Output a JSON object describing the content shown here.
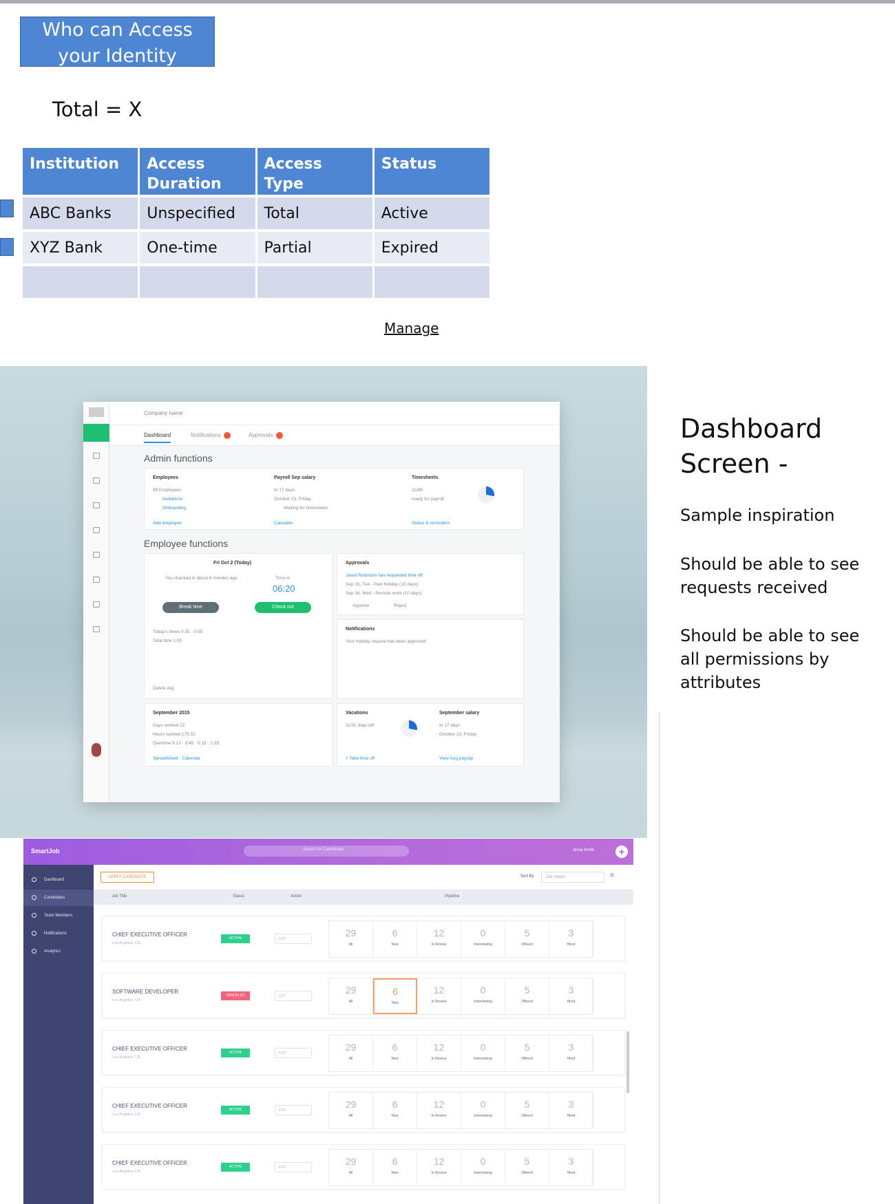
{
  "header": {
    "title": "Who can Access your Identity",
    "total": "Total = X"
  },
  "access_table": {
    "columns": [
      "Institution",
      "Access Duration",
      "Access Type",
      "Status"
    ],
    "rows": [
      [
        "ABC Banks",
        "Unspecified",
        "Total",
        "Active"
      ],
      [
        "XYZ Bank",
        "One-time",
        "Partial",
        "Expired"
      ],
      [
        "",
        "",
        "",
        ""
      ]
    ],
    "manage_link": "Manage"
  },
  "dashboard1": {
    "company": "Company name",
    "tabs": [
      "Dashboard",
      "Notifications",
      "Approvals"
    ],
    "admin_title": "Admin functions",
    "employee_title": "Employee functions",
    "cards": {
      "employees": {
        "title": "Employees",
        "lines": [
          "98 Employees",
          "Invitations",
          "Onboarding"
        ],
        "link": "Add employee"
      },
      "payroll": {
        "title": "Payroll  Sep salary",
        "lines": [
          "In 17 days",
          "October 23, Friday",
          "Waiting for timesheets"
        ],
        "link": "Calculate"
      },
      "timesheets": {
        "title": "Timesheets",
        "lines": [
          "11/98",
          "ready for payroll"
        ],
        "link": "Status & reminders"
      },
      "clock": {
        "title": "Fri Oct 2 (Today)",
        "checked": "You checked in about 6 minutes ago",
        "time_label": "Time in",
        "time": "06:20",
        "break": "Break time",
        "checkout": "Check out",
        "today": "Today's times  0:35 · 0:55",
        "total": "Total time  1:00",
        "delete": "Delete day"
      },
      "approvals": {
        "title": "Approvals",
        "lines": [
          "Jared Robinson has requested time off",
          "Sep 15, Tue - Paid holiday (10 days)",
          "Sep 16, Wed - Remote work (10 days)"
        ],
        "approve": "Approve",
        "reject": "Reject"
      },
      "notifications": {
        "title": "Notifications",
        "lines": [
          "Your holiday request has been approved"
        ]
      },
      "september": {
        "title": "September 2015",
        "lines": [
          "Days worked  22",
          "Hours worked  176:32",
          "Overtime  8:12 · 3:45 · 0:15 · 1:35"
        ],
        "links": "Spreadsheet · Calendar"
      },
      "vacations": {
        "title": "Vacations",
        "lines": [
          "11/31 days left"
        ],
        "link": "+ Take time off"
      },
      "sep_salary": {
        "title": "September salary",
        "lines": [
          "In 17 days",
          "October 23, Friday"
        ],
        "link": "View Aug payslip"
      }
    }
  },
  "smartjob": {
    "brand": "SmartJob",
    "search_placeholder": "Search for Candidates",
    "user": "Anna Smith",
    "nav": [
      "Dashboard",
      "Candidates",
      "Team Members",
      "Notifications",
      "Analytics"
    ],
    "apply_button": "APPLY CANDIDATE",
    "sort_label": "Sort By",
    "sort_value": "Job Status",
    "columns": [
      "Job Title",
      "Status",
      "Action",
      "Pipeline"
    ],
    "pipeline_labels": [
      "All",
      "New",
      "In Review",
      "Interviewing",
      "Offered",
      "Hired"
    ],
    "jobs": [
      {
        "title": "CHIEF EXECUTIVE OFFICER",
        "location": "Los Angeles, CA",
        "status": "ACTIVE",
        "action": "EDIT",
        "pipeline": [
          29,
          6,
          12,
          0,
          5,
          3
        ]
      },
      {
        "title": "SOFTWARE DEVELOPER",
        "location": "Los Angeles, CA",
        "status": "CANCELED",
        "action": "EDIT",
        "pipeline": [
          29,
          6,
          12,
          0,
          5,
          3
        ]
      },
      {
        "title": "CHIEF EXECUTIVE OFFICER",
        "location": "Los Angeles, CA",
        "status": "ACTIVE",
        "action": "EDIT",
        "pipeline": [
          29,
          6,
          12,
          0,
          5,
          3
        ]
      },
      {
        "title": "CHIEF EXECUTIVE OFFICER",
        "location": "Los Angeles, CA",
        "status": "ACTIVE",
        "action": "EDIT",
        "pipeline": [
          29,
          6,
          12,
          0,
          5,
          3
        ]
      },
      {
        "title": "CHIEF EXECUTIVE OFFICER",
        "location": "Los Angeles, CA",
        "status": "ACTIVE",
        "action": "EDIT",
        "pipeline": [
          29,
          6,
          12,
          0,
          5,
          3
        ]
      }
    ],
    "colors": {
      "active": "#2fcf8e",
      "canceled": "#f2647c",
      "brand": "#a063df"
    }
  },
  "notes": {
    "title": "Dashboard Screen  -",
    "items": [
      "Sample inspiration",
      "Should be able to see requests received",
      "Should be able to see all permissions by attributes"
    ]
  }
}
